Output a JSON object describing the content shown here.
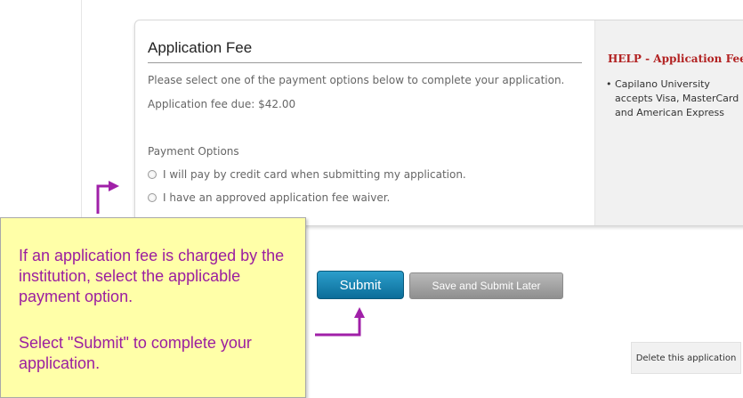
{
  "fee_section": {
    "title": "Application Fee",
    "instruction": "Please select one of the payment options below to complete your application.",
    "fee_due": "Application fee due: $42.00",
    "options_label": "Payment Options",
    "options": [
      {
        "label": "I will pay by credit card when submitting my application.",
        "selected": false
      },
      {
        "label": "I have an approved application fee waiver.",
        "selected": false
      }
    ]
  },
  "help": {
    "title": "HELP - Application Fee",
    "bullet": "Capilano University accepts Visa, MasterCard and American Express"
  },
  "callout": {
    "paragraph1": "If an application fee is charged by the institution, select the applicable payment option.",
    "paragraph2": "Select \"Submit\" to complete your application."
  },
  "actions": {
    "submit": "Submit",
    "save_later": "Save and Submit Later",
    "delete": "Delete this application"
  },
  "colors": {
    "callout_background": "#ffffa8",
    "callout_text": "#9b1ea0",
    "arrow": "#a020a8",
    "help_title": "#b22222",
    "submit_button": "#1a82b3"
  },
  "icons": [
    "radio-icon",
    "arrow-icon"
  ]
}
